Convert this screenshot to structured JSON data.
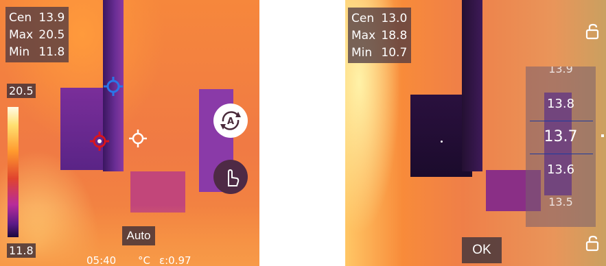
{
  "left_view": {
    "readouts": [
      {
        "label": "Cen",
        "value": "13.9"
      },
      {
        "label": "Max",
        "value": "20.5"
      },
      {
        "label": "Min",
        "value": "11.8"
      }
    ],
    "scale": {
      "max": "20.5",
      "min": "11.8"
    },
    "mode_label": "Auto",
    "status_time": "05:40",
    "status_unit": "°C",
    "status_emissivity": "ε:0.97",
    "buttons": {
      "auto_range": "auto-range-icon",
      "manual_touch": "touch-hand-icon"
    }
  },
  "right_view": {
    "readouts": [
      {
        "label": "Cen",
        "value": "13.0"
      },
      {
        "label": "Max",
        "value": "18.8"
      },
      {
        "label": "Min",
        "value": "10.7"
      }
    ],
    "picker_values": [
      "13.8",
      "13.7",
      "13.6"
    ],
    "picker_selected": "13.7",
    "ok_label": "OK",
    "icons": {
      "lock_top": "unlock-icon",
      "lock_bottom": "unlock-icon"
    }
  },
  "palette": {
    "ui_blue": "#1d3a9e",
    "marker_red": "#d8141e",
    "marker_blue": "#2a77e8"
  }
}
